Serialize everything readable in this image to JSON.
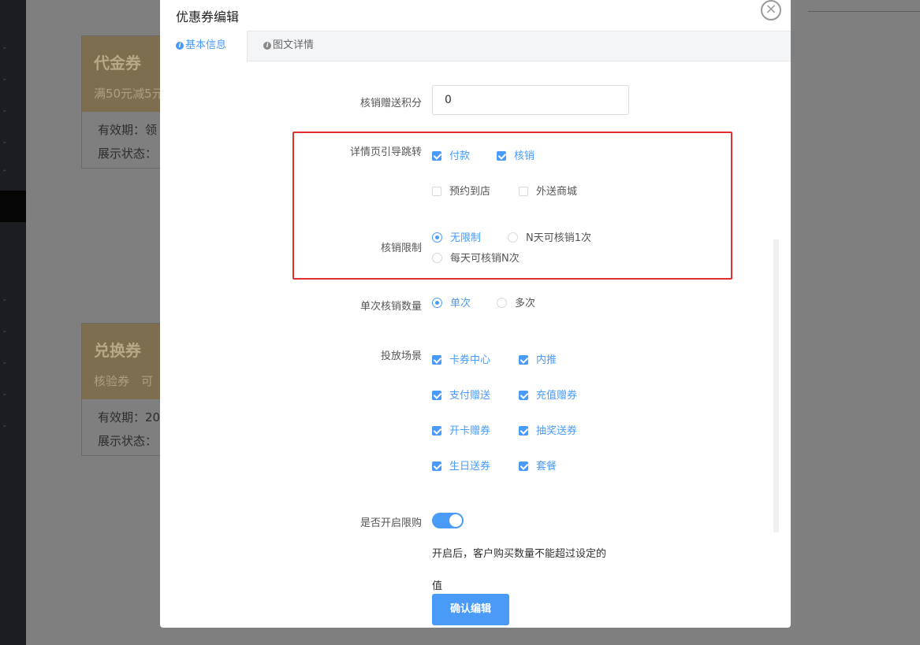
{
  "background": {
    "cards": [
      {
        "title": "代金券",
        "subtitle": "满50元减5元",
        "validity": "有效期：领",
        "display": "展示状态："
      },
      {
        "title": "兑换券",
        "subtitle": "核验券　可",
        "validity": "有效期：20",
        "display": "展示状态："
      }
    ]
  },
  "modal": {
    "title": "优惠券编辑",
    "close_icon": "×",
    "tabs": [
      {
        "label": "基本信息",
        "active": true
      },
      {
        "label": "图文详情",
        "active": false
      }
    ]
  },
  "form": {
    "points": {
      "label": "核销赠送积分",
      "value": "0"
    },
    "detail_redirect": {
      "label": "详情页引导跳转",
      "options": [
        {
          "label": "付款",
          "checked": true
        },
        {
          "label": "核销",
          "checked": true
        },
        {
          "label": "预约到店",
          "checked": false
        },
        {
          "label": "外送商城",
          "checked": false
        }
      ]
    },
    "verify_limit": {
      "label": "核销限制",
      "options": [
        {
          "label": "无限制",
          "checked": true
        },
        {
          "label": "N天可核销1次",
          "checked": false
        },
        {
          "label": "每天可核销N次",
          "checked": false
        }
      ]
    },
    "single_quantity": {
      "label": "单次核销数量",
      "options": [
        {
          "label": "单次",
          "checked": true
        },
        {
          "label": "多次",
          "checked": false
        }
      ]
    },
    "scenes": {
      "label": "投放场景",
      "options": [
        {
          "label": "卡券中心",
          "checked": true
        },
        {
          "label": "内推",
          "checked": true
        },
        {
          "label": "支付赠送",
          "checked": true
        },
        {
          "label": "充值赠券",
          "checked": true
        },
        {
          "label": "开卡赠券",
          "checked": true
        },
        {
          "label": "抽奖送券",
          "checked": true
        },
        {
          "label": "生日送券",
          "checked": true
        },
        {
          "label": "套餐",
          "checked": true
        }
      ]
    },
    "purchase_limit": {
      "label": "是否开启限购",
      "enabled": true,
      "hint_line1": "开启后，客户购买数量不能超过设定的",
      "hint_line2": "值"
    },
    "confirm_label": "确认编辑"
  },
  "colors": {
    "accent": "#4a9bf8",
    "highlight_border": "#e0302c"
  }
}
